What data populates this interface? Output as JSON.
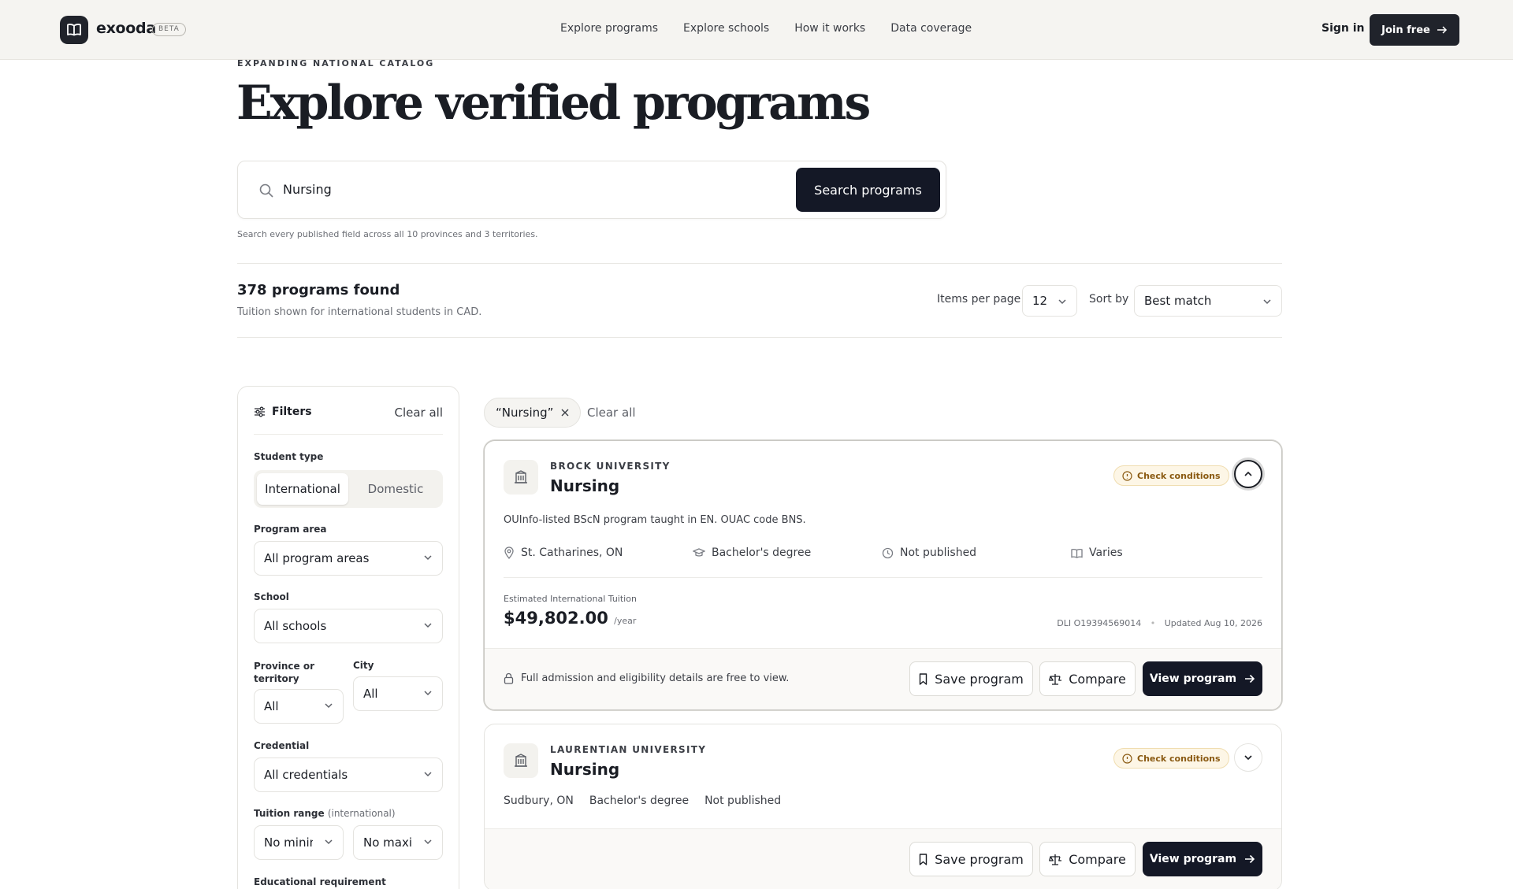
{
  "nav": {
    "brand": "exooda",
    "badge": "BETA",
    "links": [
      "Explore programs",
      "Explore schools",
      "How it works",
      "Data coverage"
    ],
    "signin": "Sign in",
    "join": "Join free"
  },
  "hero": {
    "eyebrow": "EXPANDING NATIONAL CATALOG",
    "title": "Explore verified programs",
    "search_value": "Nursing",
    "search_button": "Search programs",
    "hint": "Search every published field across all 10 provinces and 3 territories."
  },
  "results": {
    "count": "378 programs found",
    "subtitle": "Tuition shown for international students in CAD.",
    "items_per_page_label": "Items per page",
    "items_per_page_value": "12",
    "sort_label": "Sort by",
    "sort_value": "Best match"
  },
  "filters": {
    "title": "Filters",
    "clear": "Clear all",
    "student_type_label": "Student type",
    "student_types": [
      "International",
      "Domestic"
    ],
    "program_area_label": "Program area",
    "program_area_value": "All program areas",
    "school_label": "School",
    "school_value": "All schools",
    "province_label": "Province or territory",
    "province_value": "All",
    "city_label": "City",
    "city_value": "All",
    "credential_label": "Credential",
    "credential_value": "All credentials",
    "tuition_label": "Tuition range",
    "tuition_label_note": "(international)",
    "tuition_min": "No minimum",
    "tuition_max": "No maximum",
    "education_label": "Educational requirement"
  },
  "active_filters": {
    "chip": "“Nursing”",
    "clear": "Clear all"
  },
  "cards": [
    {
      "university": "BROCK UNIVERSITY",
      "program": "Nursing",
      "badge": "Check conditions",
      "description": "OUInfo-listed BScN program taught in EN. OUAC code BNS.",
      "location": "St. Catharines, ON",
      "credential": "Bachelor's degree",
      "duration": "Not published",
      "intake": "Varies",
      "tuition_label": "Estimated International Tuition",
      "tuition": "$49,802.00",
      "tuition_unit": "/year",
      "dli": "DLI O19394569014",
      "updated": "Updated Aug 10, 2026",
      "footer_note": "Full admission and eligibility details are free to view.",
      "save": "Save program",
      "compare": "Compare",
      "view": "View program"
    },
    {
      "university": "LAURENTIAN UNIVERSITY",
      "program": "Nursing",
      "badge": "Check conditions",
      "location": "Sudbury, ON",
      "credential": "Bachelor's degree",
      "duration": "Not published",
      "save": "Save program",
      "compare": "Compare",
      "view": "View program"
    }
  ]
}
